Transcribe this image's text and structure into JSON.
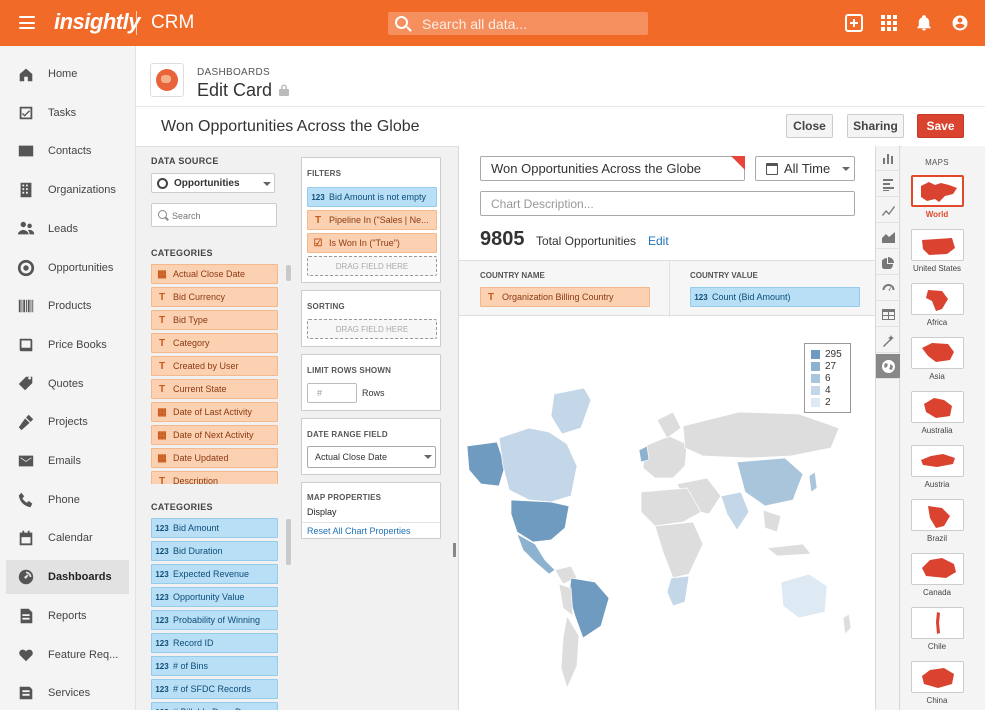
{
  "app": {
    "logo": "insightly",
    "name": "CRM",
    "search_placeholder": "Search all data...",
    "colors": {
      "brand": "#f26a28",
      "save": "#d9432f",
      "dimension": "#fcd1b2",
      "measure": "#b8dff5"
    }
  },
  "sidebar": {
    "items": [
      {
        "label": "Home",
        "icon": "home-icon"
      },
      {
        "label": "Tasks",
        "icon": "tasks-icon"
      },
      {
        "label": "Contacts",
        "icon": "contacts-icon"
      },
      {
        "label": "Organizations",
        "icon": "organizations-icon"
      },
      {
        "label": "Leads",
        "icon": "leads-icon"
      },
      {
        "label": "Opportunities",
        "icon": "opportunities-icon"
      },
      {
        "label": "Products",
        "icon": "products-icon"
      },
      {
        "label": "Price Books",
        "icon": "price-books-icon"
      },
      {
        "label": "Quotes",
        "icon": "quotes-icon"
      },
      {
        "label": "Projects",
        "icon": "projects-icon"
      },
      {
        "label": "Emails",
        "icon": "emails-icon"
      },
      {
        "label": "Phone",
        "icon": "phone-icon"
      },
      {
        "label": "Calendar",
        "icon": "calendar-icon"
      },
      {
        "label": "Dashboards",
        "icon": "dashboards-icon",
        "active": true
      },
      {
        "label": "Reports",
        "icon": "reports-icon"
      },
      {
        "label": "Feature Req...",
        "icon": "feature-request-icon"
      },
      {
        "label": "Services",
        "icon": "services-icon"
      }
    ]
  },
  "header": {
    "breadcrumb": "DASHBOARDS",
    "title": "Edit Card",
    "card_title": "Won Opportunities Across the Globe",
    "close_label": "Close",
    "sharing_label": "Sharing",
    "save_label": "Save"
  },
  "builder": {
    "data_source_label": "DATA SOURCE",
    "data_source_value": "Opportunities",
    "search_placeholder": "Search",
    "dimensions_label": "CATEGORIES",
    "dimensions": [
      {
        "icon": "date",
        "label": "Actual Close Date"
      },
      {
        "icon": "text",
        "label": "Bid Currency"
      },
      {
        "icon": "text",
        "label": "Bid Type"
      },
      {
        "icon": "text",
        "label": "Category"
      },
      {
        "icon": "text",
        "label": "Created by User"
      },
      {
        "icon": "text",
        "label": "Current State"
      },
      {
        "icon": "date",
        "label": "Date of Last Activity"
      },
      {
        "icon": "date",
        "label": "Date of Next Activity"
      },
      {
        "icon": "date",
        "label": "Date Updated"
      },
      {
        "icon": "text",
        "label": "Description"
      }
    ],
    "measures_label": "CATEGORIES",
    "measures": [
      {
        "label": "Bid Amount"
      },
      {
        "label": "Bid Duration"
      },
      {
        "label": "Expected Revenue"
      },
      {
        "label": "Opportunity Value"
      },
      {
        "label": "Probability of Winning"
      },
      {
        "label": "Record ID"
      },
      {
        "label": "# of Bins"
      },
      {
        "label": "# of SFDC Records"
      },
      {
        "label": "# Billable Days D..."
      }
    ],
    "filters": {
      "title": "FILTERS",
      "items": [
        {
          "type": "measure",
          "icon": "123",
          "label": "Bid Amount is not empty"
        },
        {
          "type": "dimension",
          "icon": "T",
          "label": "Pipeline In (\"Sales | Ne..."
        },
        {
          "type": "dimension",
          "icon": "check",
          "label": "Is Won In (\"True\")"
        }
      ],
      "drop_label": "DRAG FIELD HERE"
    },
    "sorting": {
      "title": "SORTING",
      "drop_label": "DRAG FIELD HERE"
    },
    "limit": {
      "title": "LIMIT ROWS SHOWN",
      "placeholder": "#",
      "rows_label": "Rows"
    },
    "date_range": {
      "title": "DATE RANGE FIELD",
      "value": "Actual Close Date"
    },
    "map_props": {
      "title": "MAP PROPERTIES",
      "display_label": "Display",
      "reset_label": "Reset All Chart Properties"
    }
  },
  "chart": {
    "title_value": "Won Opportunities Across the Globe",
    "time_value": "All Time",
    "description_placeholder": "Chart Description...",
    "total": "9805",
    "total_label": "Total Opportunities",
    "edit_label": "Edit",
    "country_col_label": "COUNTRY NAME",
    "country_field": "Organization Billing Country",
    "value_col_label": "COUNTRY VALUE",
    "value_field": "Count (Bid Amount)",
    "legend": [
      {
        "label": "295",
        "color": "#6e9bbf"
      },
      {
        "label": "27",
        "color": "#8db2cf"
      },
      {
        "label": "6",
        "color": "#a9c5dc"
      },
      {
        "label": "4",
        "color": "#c3d7e8"
      },
      {
        "label": "2",
        "color": "#ddeaf4"
      }
    ]
  },
  "chart_types": [
    "bar-chart-icon",
    "horizontal-bar-icon",
    "line-chart-icon",
    "area-chart-icon",
    "pie-chart-icon",
    "gauge-icon",
    "table-icon",
    "magic-icon",
    "globe-icon"
  ],
  "maps": {
    "title": "MAPS",
    "items": [
      {
        "label": "World",
        "active": true
      },
      {
        "label": "United States"
      },
      {
        "label": "Africa"
      },
      {
        "label": "Asia"
      },
      {
        "label": "Australia"
      },
      {
        "label": "Austria"
      },
      {
        "label": "Brazil"
      },
      {
        "label": "Canada"
      },
      {
        "label": "Chile"
      },
      {
        "label": "China"
      }
    ]
  }
}
